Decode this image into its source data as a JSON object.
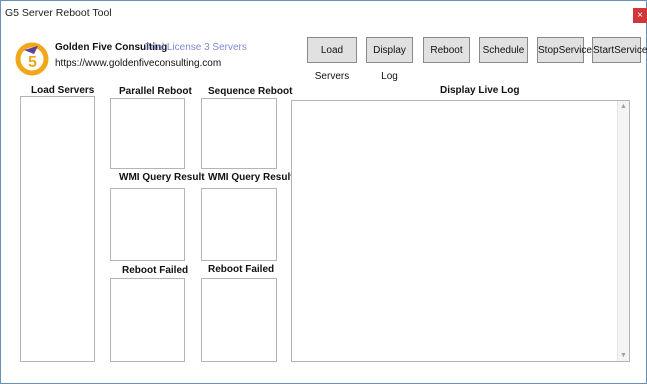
{
  "window": {
    "title": "G5 Server Reboot Tool",
    "close_glyph": "×"
  },
  "header": {
    "company": "Golden Five Consulting",
    "license": "Trial License 3 Servers",
    "url": "https://www.goldenfiveconsulting.com"
  },
  "toolbar": {
    "load_servers": "Load Servers",
    "display_log": "Display Log",
    "reboot": "Reboot",
    "schedule": "Schedule",
    "stop_services": "StopServices",
    "start_services": "StartServices"
  },
  "panels": {
    "load_servers": "Load Servers",
    "parallel_reboot": "Parallel Reboot",
    "sequence_reboot": "Sequence Reboot",
    "wmi_query_result_1": "WMI Query Result",
    "wmi_query_result_2": "WMI Query Result",
    "reboot_failed_1": "Reboot Failed",
    "reboot_failed_2": "Reboot Failed",
    "display_live_log": "Display Live Log"
  },
  "colors": {
    "close_button": "#d1363a",
    "license_text": "#7f86d6",
    "logo_gold": "#f0a81a",
    "logo_purple": "#5b3f98"
  },
  "icons": {
    "close": "close-icon",
    "logo": "g5-logo-icon",
    "scroll_up": "scroll-up-arrow-icon",
    "scroll_down": "scroll-down-arrow-icon"
  }
}
